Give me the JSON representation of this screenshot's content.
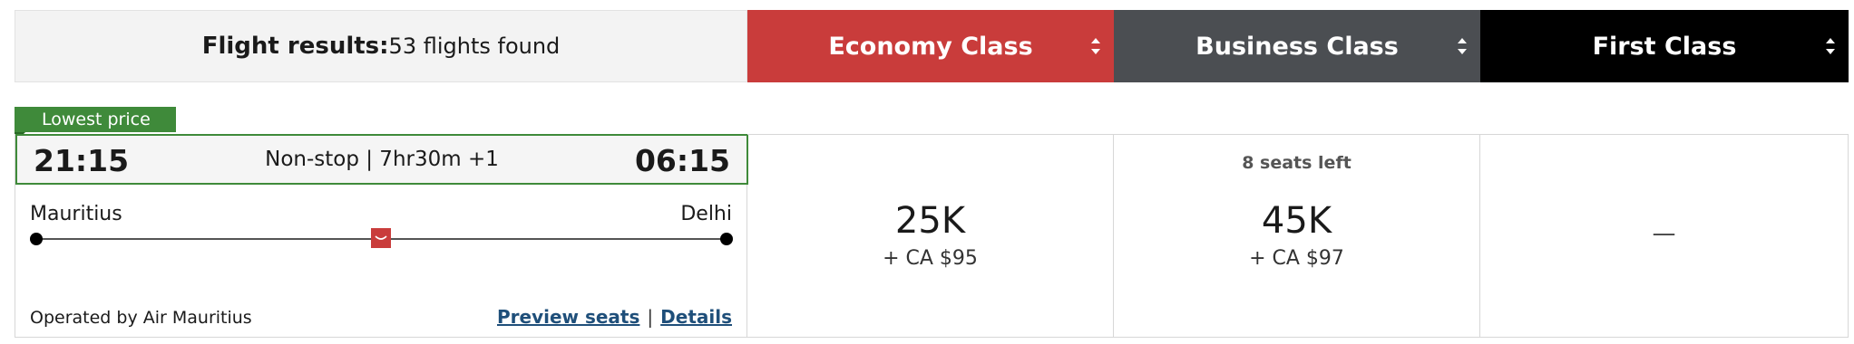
{
  "header": {
    "results_label": "Flight results:",
    "results_count": "53 flights found",
    "cabins": [
      {
        "label": "Economy Class",
        "color": "#c93c3b"
      },
      {
        "label": "Business Class",
        "color": "#4b4e52"
      },
      {
        "label": "First Class",
        "color": "#000000"
      }
    ]
  },
  "flight": {
    "badge": "Lowest price",
    "departure_time": "21:15",
    "arrival_time": "06:15",
    "duration": "Non-stop | 7hr30m +1",
    "origin": "Mauritius",
    "destination": "Delhi",
    "operated_by": "Operated by Air Mauritius",
    "preview_seats": "Preview seats",
    "link_separator": "|",
    "details": "Details",
    "accent_color": "#3f8a3a",
    "airline_logo_icon": "air-mauritius-logo-icon"
  },
  "fares": {
    "economy": {
      "miles": "25K",
      "tax": "+ CA $95"
    },
    "business": {
      "seats_left": "8 seats left",
      "miles": "45K",
      "tax": "+ CA $97"
    },
    "first": {
      "unavailable": "—"
    }
  }
}
